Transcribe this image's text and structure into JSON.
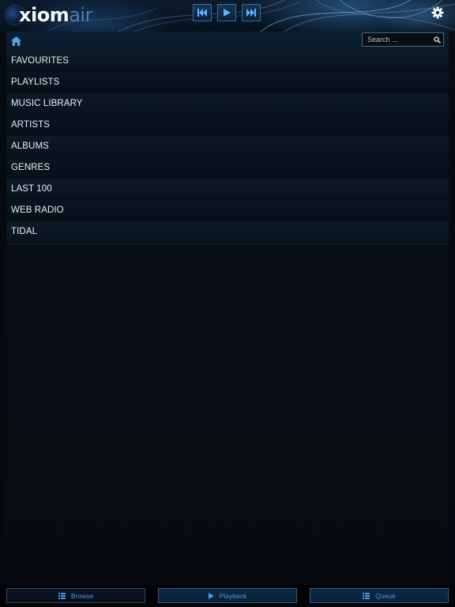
{
  "header": {
    "logo_main": "xiom",
    "logo_suffix": "air"
  },
  "toolbar": {
    "search_placeholder": "Search ..."
  },
  "menu": {
    "items": [
      {
        "label": "FAVOURITES"
      },
      {
        "label": "PLAYLISTS"
      },
      {
        "label": "MUSIC LIBRARY"
      },
      {
        "label": "ARTISTS"
      },
      {
        "label": "ALBUMS"
      },
      {
        "label": "GENRES"
      },
      {
        "label": "LAST 100"
      },
      {
        "label": "WEB RADIO"
      },
      {
        "label": "TIDAL"
      }
    ]
  },
  "bottom_nav": {
    "browse": "Browse",
    "playback": "Playback",
    "queue": "Queue"
  },
  "icons": {
    "prev": "skip-previous-icon",
    "play": "play-icon",
    "next": "skip-next-icon",
    "settings": "gear-icon",
    "home": "home-icon",
    "search": "search-icon",
    "browse": "list-icon",
    "playback": "play-icon",
    "queue": "list-icon"
  },
  "colors": {
    "accent": "#4a9be6",
    "text": "#e9eef3",
    "button_border": "#3b6d9b"
  }
}
